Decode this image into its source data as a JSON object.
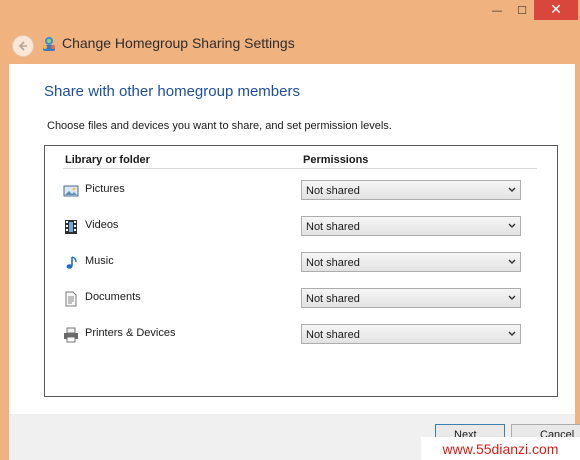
{
  "window": {
    "title": "Change Homegroup Sharing Settings",
    "minimize_glyph": "—",
    "maximize_glyph": "☐",
    "close_glyph": "✕"
  },
  "main": {
    "heading": "Share with other homegroup members",
    "description": "Choose files and devices you want to share, and set permission levels."
  },
  "table": {
    "columns": {
      "library": "Library or folder",
      "permissions": "Permissions"
    },
    "rows": [
      {
        "label": "Pictures",
        "icon": "pictures-icon",
        "permission": "Not shared"
      },
      {
        "label": "Videos",
        "icon": "videos-icon",
        "permission": "Not shared"
      },
      {
        "label": "Music",
        "icon": "music-icon",
        "permission": "Not shared"
      },
      {
        "label": "Documents",
        "icon": "documents-icon",
        "permission": "Not shared"
      },
      {
        "label": "Printers & Devices",
        "icon": "printer-icon",
        "permission": "Not shared"
      }
    ]
  },
  "footer": {
    "next_label": "Next",
    "cancel_label": "Cancel"
  },
  "watermark": "www.55dianzi.com",
  "colors": {
    "titlebar": "#f0b27f",
    "close_button": "#d9473c",
    "heading": "#1e4e9c",
    "watermark": "#d51f16"
  }
}
